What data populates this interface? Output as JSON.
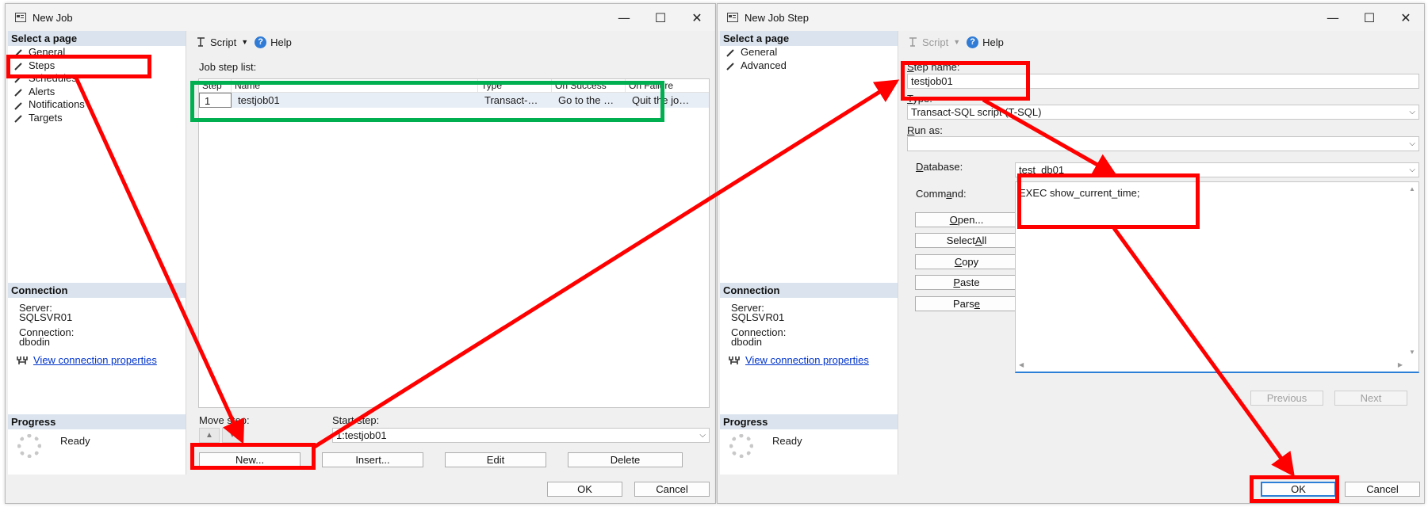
{
  "left_window": {
    "title": "New Job",
    "controls": {
      "minimize": "—",
      "maximize": "☐",
      "close": "✕"
    },
    "select_page_header": "Select a page",
    "pages": [
      "General",
      "Steps",
      "Schedules",
      "Alerts",
      "Notifications",
      "Targets"
    ],
    "toolbar": {
      "script": "Script",
      "help": "Help"
    },
    "job_step_list_label": "Job step list:",
    "grid": {
      "columns": [
        "Step",
        "Name",
        "Type",
        "On Success",
        "On Failure"
      ],
      "rows": [
        {
          "step": "1",
          "name": "testjob01",
          "type": "Transact-…",
          "on_success": "Go to the …",
          "on_failure": "Quit the jo…"
        }
      ]
    },
    "move_step_label": "Move step:",
    "start_step_label": "Start step:",
    "start_step_value": "1:testjob01",
    "buttons": {
      "new": "New...",
      "insert": "Insert...",
      "edit": "Edit",
      "delete": "Delete",
      "ok": "OK",
      "cancel": "Cancel"
    },
    "connection": {
      "header": "Connection",
      "server_label": "Server:",
      "server_value": "SQLSVR01",
      "connection_label": "Connection:",
      "connection_value": "dbodin",
      "link": "View connection properties"
    },
    "progress": {
      "header": "Progress",
      "status": "Ready"
    }
  },
  "right_window": {
    "title": "New Job Step",
    "controls": {
      "minimize": "—",
      "maximize": "☐",
      "close": "✕"
    },
    "select_page_header": "Select a page",
    "pages": [
      "General",
      "Advanced"
    ],
    "toolbar": {
      "script": "Script",
      "help": "Help"
    },
    "step_name_label_prefix": "S",
    "step_name_label_rest": "tep name:",
    "step_name_value": "testjob01",
    "type_label_prefix": "T",
    "type_label_rest": "ype:",
    "type_value": "Transact-SQL script (T-SQL)",
    "run_as_label_prefix": "R",
    "run_as_label_rest": "un as:",
    "run_as_value": "",
    "database_label_prefix": "D",
    "database_label_rest": "atabase:",
    "database_value": "test_db01",
    "command_label_pre": "Comm",
    "command_label_u": "a",
    "command_label_post": "nd:",
    "command_value": "EXEC show_current_time;",
    "side_buttons": {
      "open_u": "O",
      "open_rest": "pen...",
      "select_all_pre": "Select ",
      "select_all_u": "A",
      "select_all_post": "ll",
      "copy_u": "C",
      "copy_rest": "opy",
      "paste_u": "P",
      "paste_rest": "aste",
      "parse_pre": "Pars",
      "parse_u": "e"
    },
    "nav_buttons": {
      "previous": "Previous",
      "next": "Next"
    },
    "buttons": {
      "ok": "OK",
      "cancel": "Cancel"
    },
    "connection": {
      "header": "Connection",
      "server_label": "Server:",
      "server_value": "SQLSVR01",
      "connection_label": "Connection:",
      "connection_value": "dbodin",
      "link": "View connection properties"
    },
    "progress": {
      "header": "Progress",
      "status": "Ready"
    }
  },
  "annotations": {
    "highlight_color": "#ff0000",
    "grid_highlight_color": "#00b050",
    "accent": "#2b7fd6"
  }
}
